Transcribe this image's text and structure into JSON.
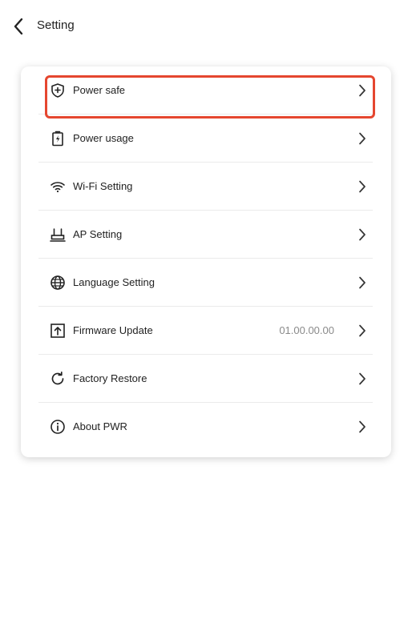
{
  "header": {
    "title": "Setting",
    "back_icon": "chevron-left-icon"
  },
  "menu": {
    "items": [
      {
        "id": "power-safe",
        "label": "Power safe",
        "icon": "shield-plus-icon",
        "value": ""
      },
      {
        "id": "power-usage",
        "label": "Power usage",
        "icon": "battery-bolt-icon",
        "value": ""
      },
      {
        "id": "wifi-setting",
        "label": "Wi-Fi Setting",
        "icon": "wifi-icon",
        "value": ""
      },
      {
        "id": "ap-setting",
        "label": "AP Setting",
        "icon": "router-icon",
        "value": ""
      },
      {
        "id": "language-setting",
        "label": "Language Setting",
        "icon": "globe-icon",
        "value": ""
      },
      {
        "id": "firmware-update",
        "label": "Firmware Update",
        "icon": "upload-icon",
        "value": "01.00.00.00"
      },
      {
        "id": "factory-restore",
        "label": "Factory Restore",
        "icon": "refresh-icon",
        "value": ""
      },
      {
        "id": "about-pwr",
        "label": "About PWR",
        "icon": "info-icon",
        "value": ""
      }
    ]
  },
  "highlight": {
    "target": "power-safe",
    "color": "#e5462f"
  },
  "colors": {
    "text": "#222222",
    "secondary_text": "#8a8a8a",
    "divider": "#ebebeb",
    "background": "#ffffff"
  }
}
